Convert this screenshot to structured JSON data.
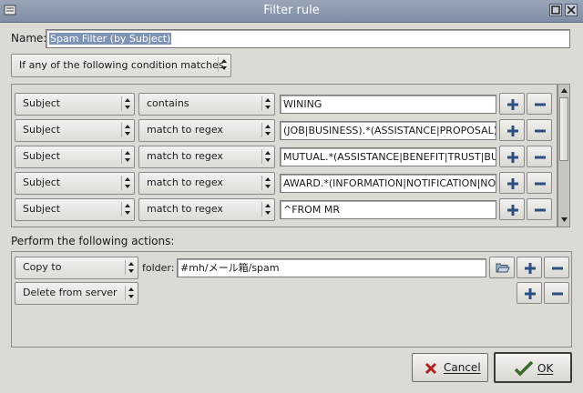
{
  "window": {
    "title": "Filter rule"
  },
  "name_field": {
    "label": "Name:",
    "value": "Spam Filter (by Subject)"
  },
  "condition_mode": {
    "value": "If any of the following condition matches"
  },
  "conditions": [
    {
      "field": "Subject",
      "operator": "contains",
      "value": "WINING"
    },
    {
      "field": "Subject",
      "operator": "match to regex",
      "value": "(JOB|BUSINESS).*(ASSISTANCE|PROPOSAL)"
    },
    {
      "field": "Subject",
      "operator": "match to regex",
      "value": "MUTUAL.*(ASSISTANCE|BENEFIT|TRUST|BUSI"
    },
    {
      "field": "Subject",
      "operator": "match to regex",
      "value": "AWARD.*(INFORMATION|NOTIFICATION|NOT"
    },
    {
      "field": "Subject",
      "operator": "match to regex",
      "value": "^FROM MR"
    }
  ],
  "actions_label": "Perform the following actions:",
  "actions": [
    {
      "action": "Copy to",
      "folder_label": "folder:",
      "folder_value": "#mh/メール箱/spam"
    },
    {
      "action": "Delete from server"
    }
  ],
  "buttons": {
    "cancel": "Cancel",
    "ok": "OK"
  }
}
